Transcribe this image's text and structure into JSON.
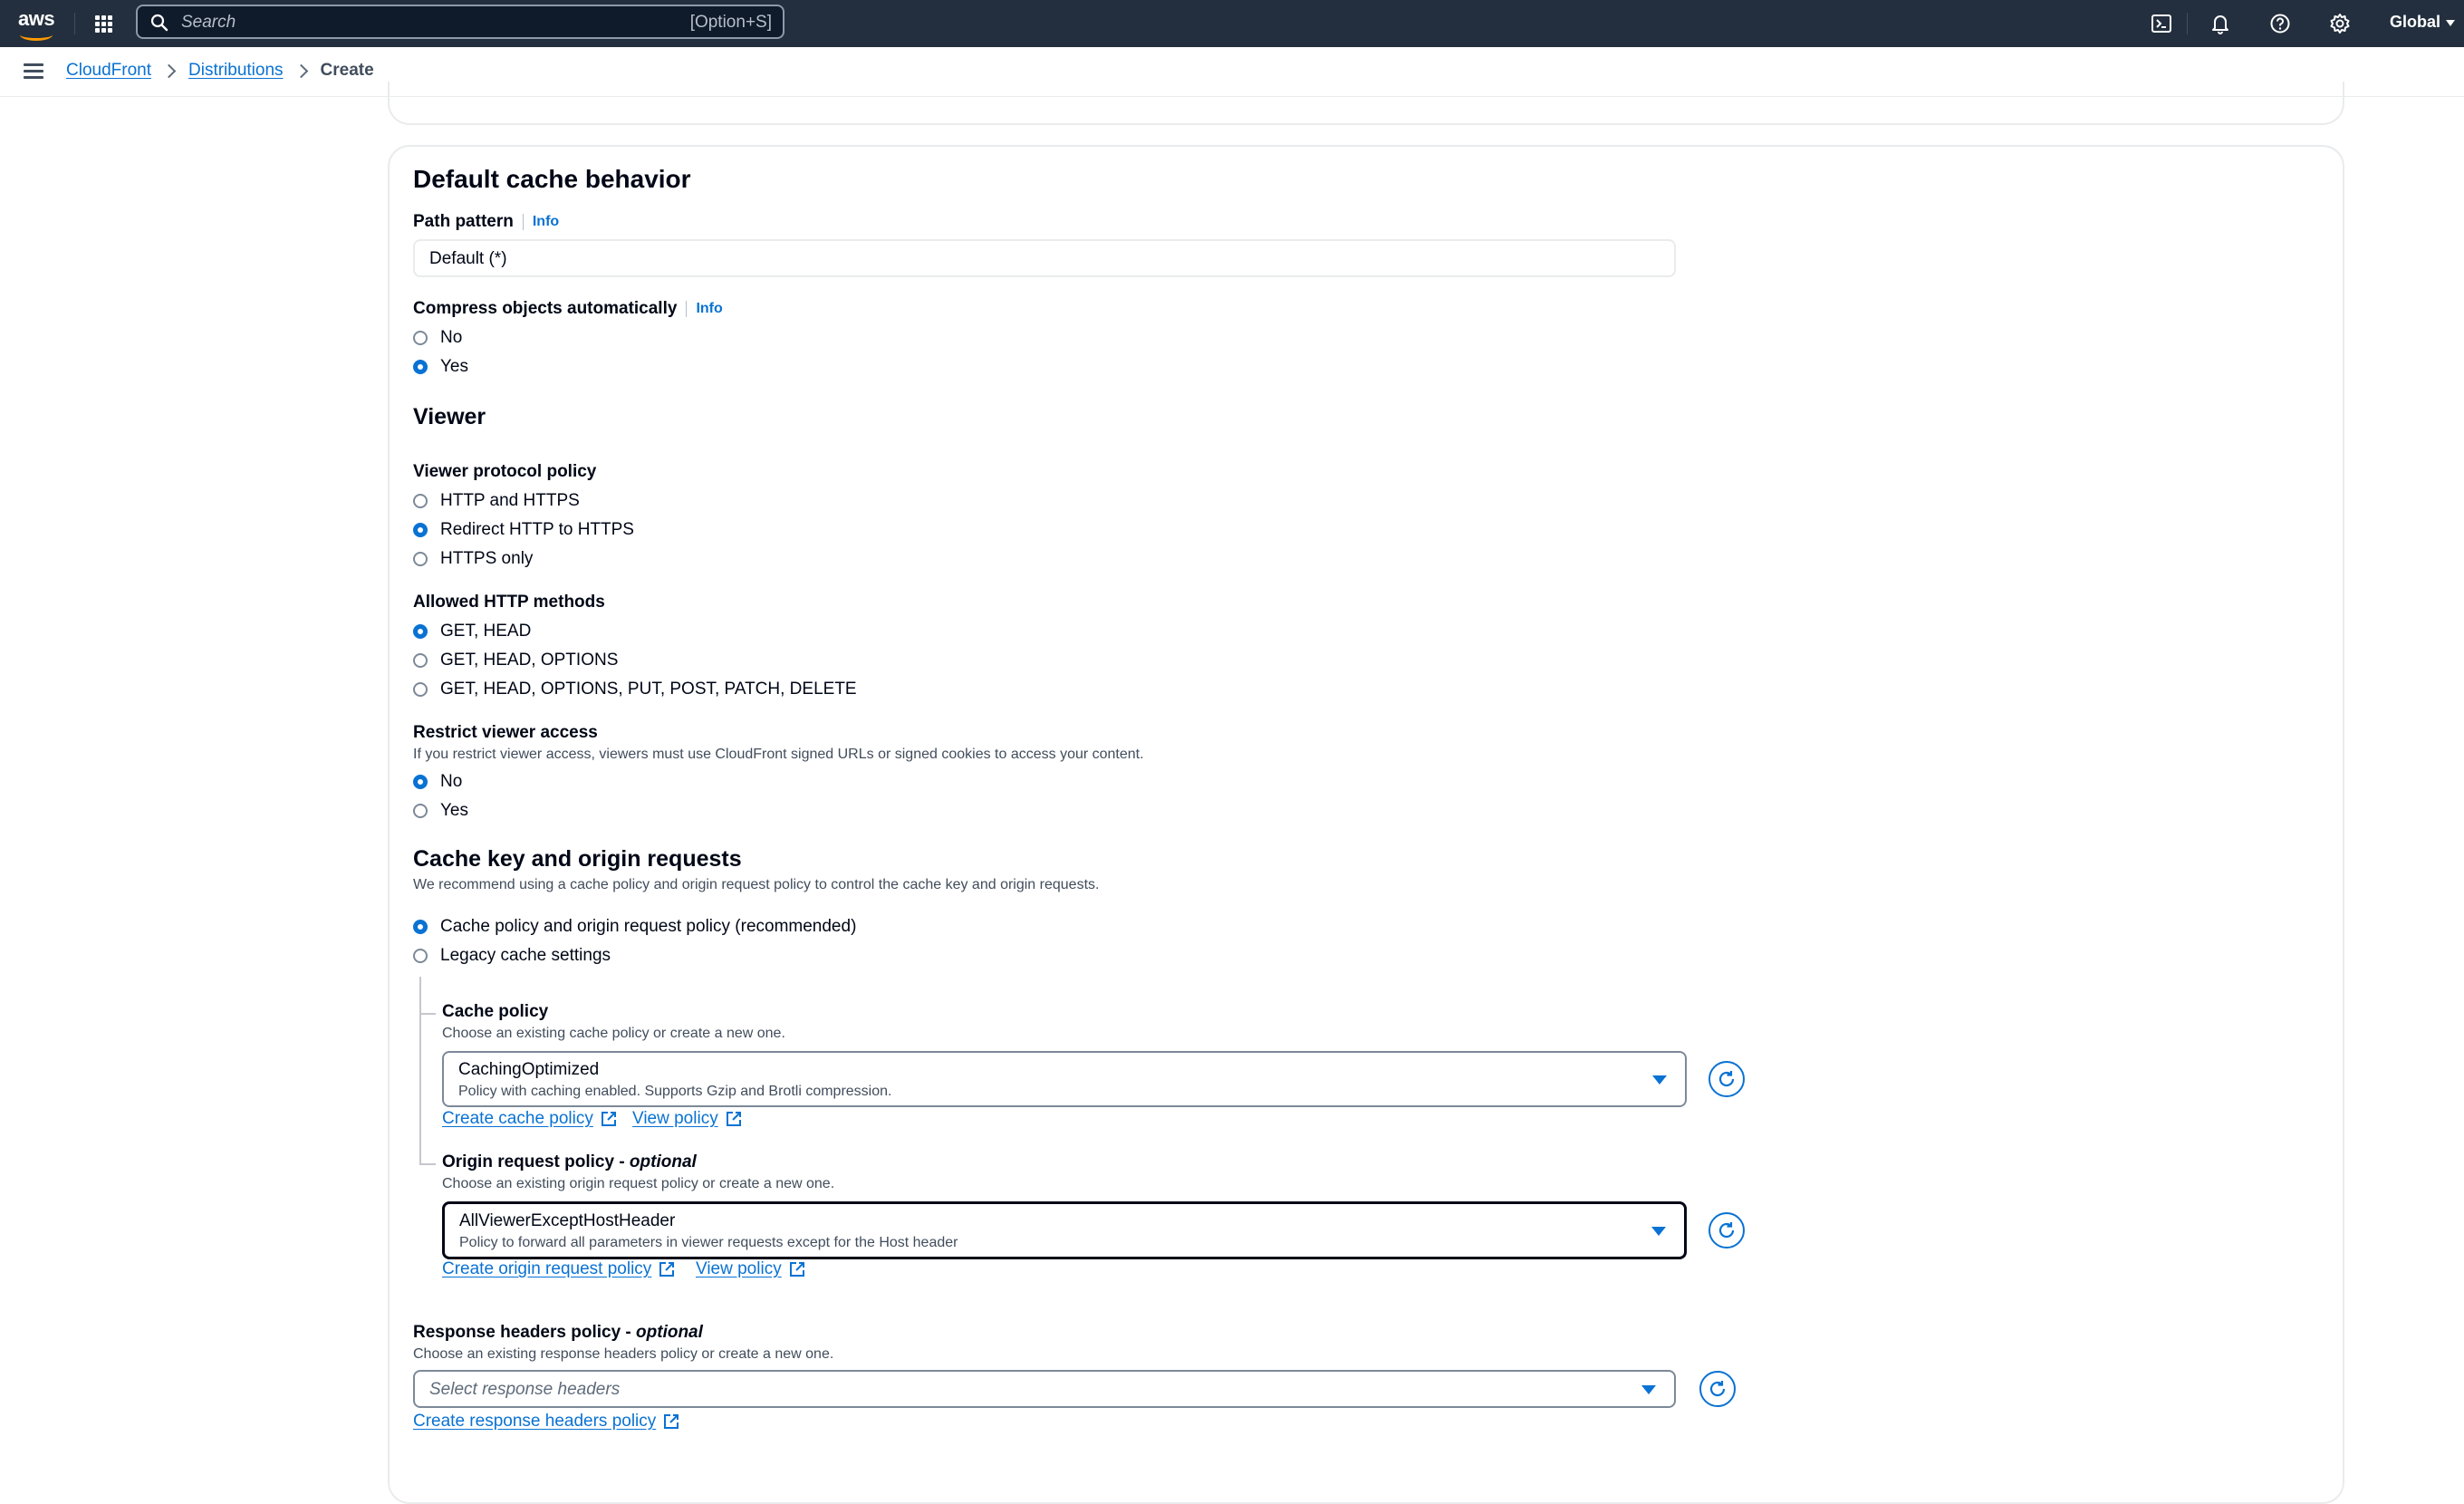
{
  "topnav": {
    "logo_text": "aws",
    "search_placeholder": "Search",
    "search_shortcut": "[Option+S]",
    "region": "Global",
    "icons": [
      "cloudshell-icon",
      "bell-icon",
      "help-icon",
      "gear-icon"
    ]
  },
  "breadcrumb": {
    "items": [
      "CloudFront",
      "Distributions"
    ],
    "current": "Create"
  },
  "section": {
    "title": "Default cache behavior",
    "path_pattern": {
      "label": "Path pattern",
      "info": "Info",
      "value": "Default (*)"
    },
    "compress": {
      "label": "Compress objects automatically",
      "info": "Info",
      "options": [
        "No",
        "Yes"
      ],
      "selected": "Yes"
    }
  },
  "viewer": {
    "title": "Viewer",
    "protocol": {
      "label": "Viewer protocol policy",
      "options": [
        "HTTP and HTTPS",
        "Redirect HTTP to HTTPS",
        "HTTPS only"
      ],
      "selected": "Redirect HTTP to HTTPS"
    },
    "methods": {
      "label": "Allowed HTTP methods",
      "options": [
        "GET, HEAD",
        "GET, HEAD, OPTIONS",
        "GET, HEAD, OPTIONS, PUT, POST, PATCH, DELETE"
      ],
      "selected": "GET, HEAD"
    },
    "restrict": {
      "label": "Restrict viewer access",
      "description": "If you restrict viewer access, viewers must use CloudFront signed URLs or signed cookies to access your content.",
      "options": [
        "No",
        "Yes"
      ],
      "selected": "No"
    }
  },
  "cache_key": {
    "title": "Cache key and origin requests",
    "description": "We recommend using a cache policy and origin request policy to control the cache key and origin requests.",
    "options": [
      "Cache policy and origin request policy (recommended)",
      "Legacy cache settings"
    ],
    "selected": "Cache policy and origin request policy (recommended)",
    "cache_policy": {
      "label": "Cache policy",
      "description": "Choose an existing cache policy or create a new one.",
      "value": "CachingOptimized",
      "value_description": "Policy with caching enabled. Supports Gzip and Brotli compression.",
      "create_link": "Create cache policy",
      "view_link": "View policy"
    },
    "origin_request_policy": {
      "label": "Origin request policy - ",
      "label_optional": "optional",
      "description": "Choose an existing origin request policy or create a new one.",
      "value": "AllViewerExceptHostHeader",
      "value_description": "Policy to forward all parameters in viewer requests except for the Host header",
      "create_link": "Create origin request policy",
      "view_link": "View policy"
    }
  },
  "response_headers": {
    "label": "Response headers policy - ",
    "label_optional": "optional",
    "description": "Choose an existing response headers policy or create a new one.",
    "placeholder": "Select response headers",
    "create_link": "Create response headers policy"
  },
  "colors": {
    "nav_bg": "#232f3e",
    "link": "#0972d3",
    "text": "#000716",
    "muted": "#414d5c"
  }
}
